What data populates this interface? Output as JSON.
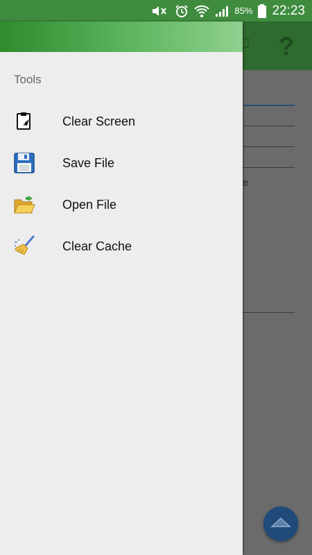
{
  "status_bar": {
    "battery_percent": "85%",
    "time": "22:23",
    "icons": [
      "mute-icon",
      "alarm-icon",
      "wifi-icon",
      "signal-icon",
      "battery-icon"
    ]
  },
  "background_app": {
    "toolbar_icons": [
      "chip-icon",
      "help-icon"
    ],
    "help_glyph": "?",
    "content_fragment": "e",
    "fab_icon": "arrow-up-icon"
  },
  "drawer": {
    "section_title": "Tools",
    "items": [
      {
        "label": "Clear Screen",
        "icon": "clipboard-clear-icon"
      },
      {
        "label": "Save File",
        "icon": "floppy-disk-icon"
      },
      {
        "label": "Open File",
        "icon": "open-folder-icon"
      },
      {
        "label": "Clear Cache",
        "icon": "broom-icon"
      }
    ]
  },
  "colors": {
    "status_bar": "#3f8c3f",
    "drawer_header_start": "#2e8b2e",
    "drawer_header_end": "#8fd08f",
    "drawer_bg": "#ededed",
    "scrim": "#6b6b6b",
    "fab": "#1f4a7a"
  }
}
